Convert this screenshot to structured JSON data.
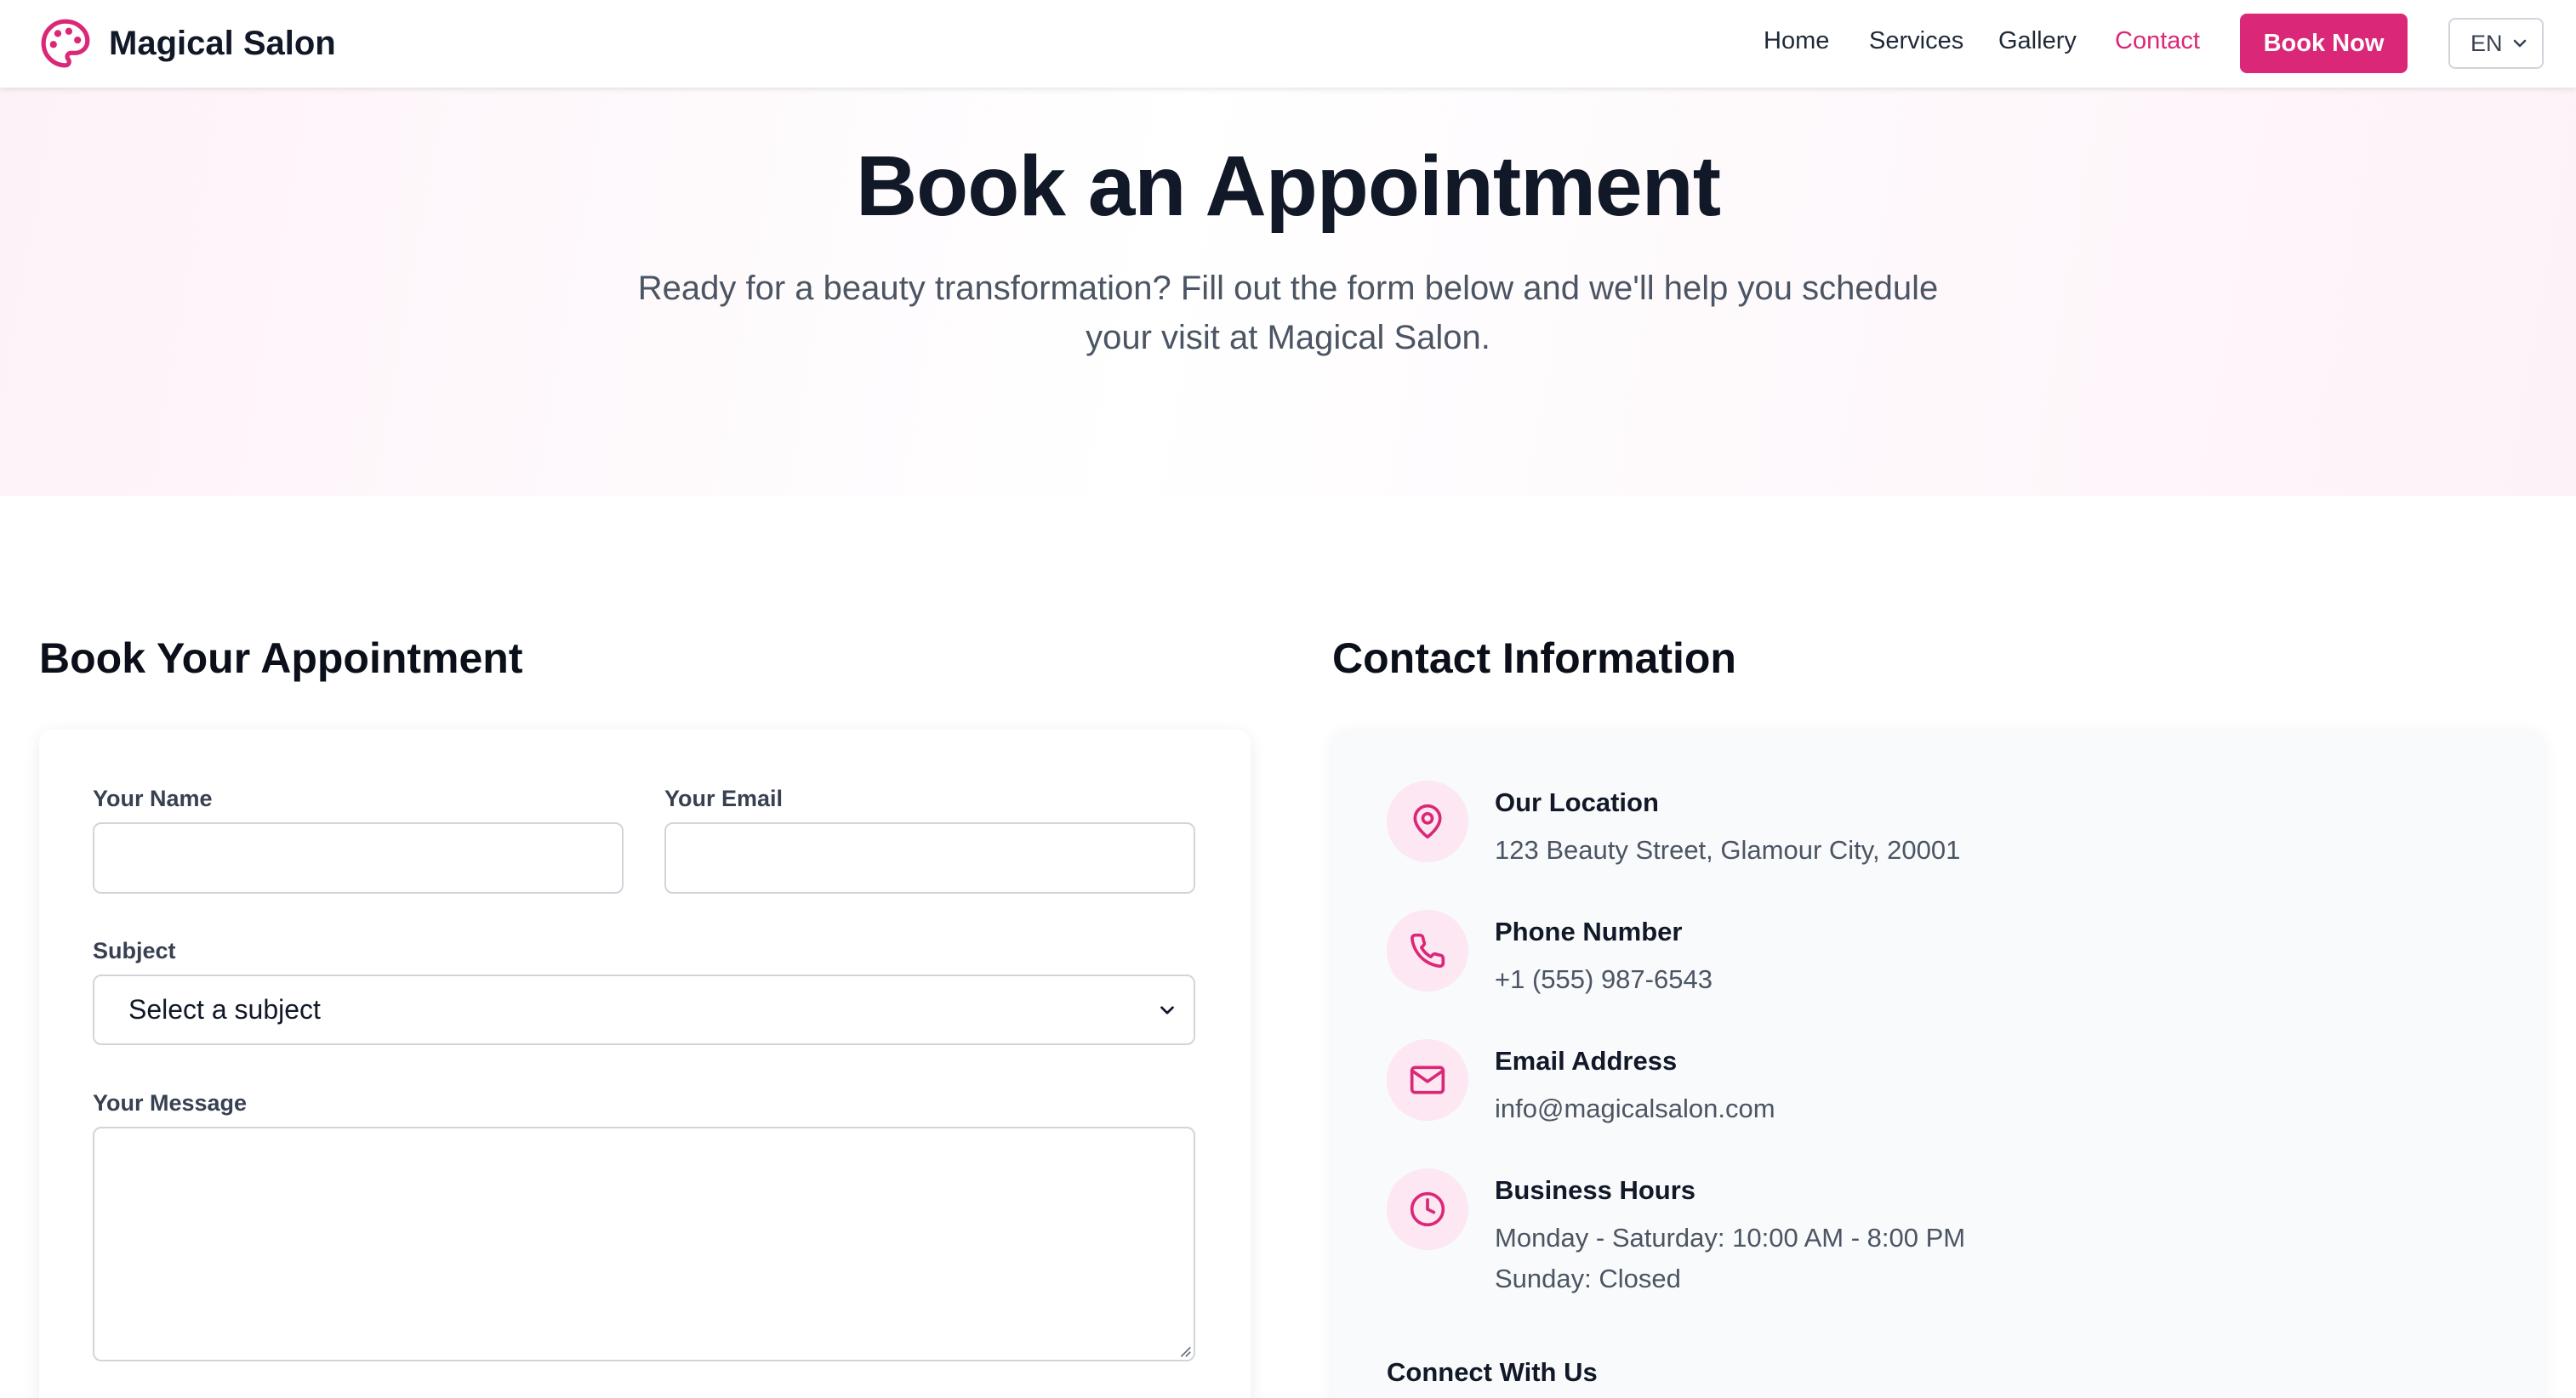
{
  "brand": {
    "name": "Magical Salon",
    "icon": "palette-icon"
  },
  "nav": {
    "links": [
      {
        "label": "Home",
        "active": false
      },
      {
        "label": "Services",
        "active": false
      },
      {
        "label": "Gallery",
        "active": false
      },
      {
        "label": "Contact",
        "active": true
      }
    ],
    "cta_label": "Book Now",
    "language": "EN"
  },
  "hero": {
    "title": "Book an Appointment",
    "subtitle_line1": "Ready for a beauty transformation? Fill out the form below and we'll help you schedule",
    "subtitle_line2": "your visit at Magical Salon."
  },
  "form": {
    "heading": "Book Your Appointment",
    "name_label": "Your Name",
    "name_value": "",
    "email_label": "Your Email",
    "email_value": "",
    "subject_label": "Subject",
    "subject_selected": "Select a subject",
    "message_label": "Your Message",
    "message_value": ""
  },
  "contact": {
    "heading": "Contact Information",
    "items": [
      {
        "icon": "map-pin-icon",
        "title": "Our Location",
        "lines": [
          "123 Beauty Street, Glamour City, 20001"
        ]
      },
      {
        "icon": "phone-icon",
        "title": "Phone Number",
        "lines": [
          "+1 (555) 987-6543"
        ]
      },
      {
        "icon": "mail-icon",
        "title": "Email Address",
        "lines": [
          "info@magicalsalon.com"
        ]
      },
      {
        "icon": "clock-icon",
        "title": "Business Hours",
        "lines": [
          "Monday - Saturday: 10:00 AM - 8:00 PM",
          "Sunday: Closed"
        ]
      }
    ],
    "connect_heading": "Connect With Us"
  },
  "colors": {
    "accent": "#db2777",
    "accent_soft": "#fce7f3",
    "text_dark": "#111827",
    "text_muted": "#4b5563"
  }
}
